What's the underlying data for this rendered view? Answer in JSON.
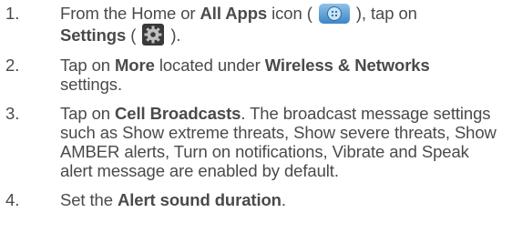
{
  "steps": [
    {
      "number": "1.",
      "parts": {
        "a": "From the Home or ",
        "b": "All Apps",
        "c": " icon ( ",
        "d": " ), tap on ",
        "e": "Settings",
        "f": " ( ",
        "g": " )."
      },
      "icons": [
        "all-apps-icon",
        "settings-gear-icon"
      ]
    },
    {
      "number": "2.",
      "parts": {
        "a": "Tap on ",
        "b": "More",
        "c": " located under ",
        "d": "Wireless & Networks",
        "e": " settings."
      }
    },
    {
      "number": "3.",
      "parts": {
        "a": "Tap on ",
        "b": "Cell Broadcasts",
        "c": ". The broadcast message settings such as Show extreme threats, Show severe threats, Show AMBER alerts, Turn on notifications, Vibrate and Speak alert message are enabled by default."
      }
    },
    {
      "number": "4.",
      "parts": {
        "a": "Set the ",
        "b": "Alert sound duration",
        "c": "."
      }
    }
  ]
}
